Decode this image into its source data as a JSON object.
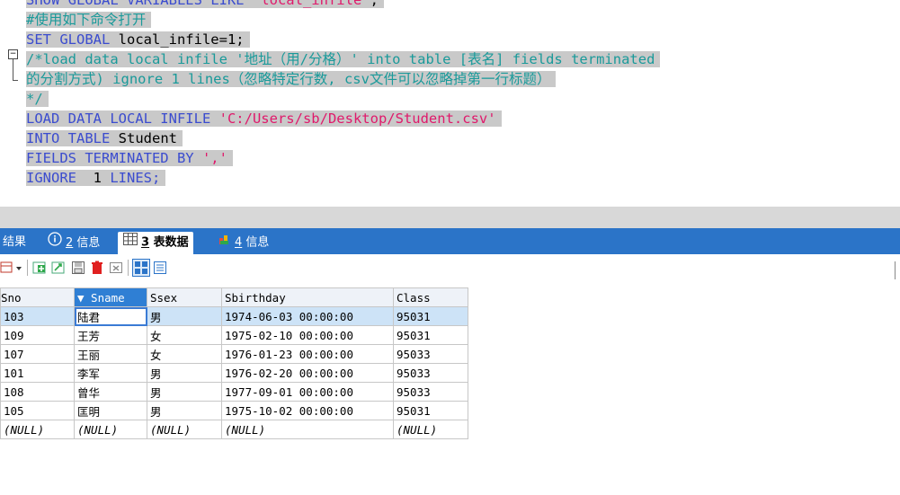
{
  "editor": {
    "lines": [
      {
        "parts": [
          {
            "t": "SHOW GLOBAL VARIABLES LIKE ",
            "c": "kw"
          },
          {
            "t": "'local_infile'",
            "c": "str"
          },
          {
            "t": ";",
            "c": "plain"
          }
        ]
      },
      {
        "parts": [
          {
            "t": "#使用如下命令打开",
            "c": "cmt"
          }
        ]
      },
      {
        "parts": [
          {
            "t": "SET GLOBAL ",
            "c": "kw"
          },
          {
            "t": "local_infile=1;",
            "c": "plain"
          }
        ]
      },
      {
        "parts": [
          {
            "t": "/*load data local infile '地址（用/分格）' into table [表名] fields terminated",
            "c": "cmt"
          }
        ]
      },
      {
        "parts": [
          {
            "t": "的分割方式) ignore 1 lines（忽略特定行数, csv文件可以忽略掉第一行标题）",
            "c": "cmt"
          }
        ]
      },
      {
        "parts": [
          {
            "t": "*/",
            "c": "cmt"
          }
        ]
      },
      {
        "parts": [
          {
            "t": "LOAD DATA LOCAL INFILE ",
            "c": "kw"
          },
          {
            "t": "'C:/Users/sb/Desktop/Student.csv'",
            "c": "str"
          }
        ]
      },
      {
        "parts": [
          {
            "t": "INTO TABLE ",
            "c": "kw"
          },
          {
            "t": "Student",
            "c": "plain"
          }
        ]
      },
      {
        "parts": [
          {
            "t": "FIELDS TERMINATED BY ",
            "c": "kw"
          },
          {
            "t": "','",
            "c": "str"
          }
        ]
      },
      {
        "parts": [
          {
            "t": "IGNORE  ",
            "c": "kw"
          },
          {
            "t": "1",
            "c": "plain"
          },
          {
            "t": " LINES;",
            "c": "kw"
          }
        ]
      }
    ]
  },
  "tabs": {
    "result_label": "结果",
    "info_num": "2",
    "info_label": "信息",
    "table_num": "3",
    "table_label": "表数据",
    "info2_num": "4",
    "info2_label": "信息"
  },
  "grid": {
    "columns": [
      "Sno",
      "▼ Sname",
      "Ssex",
      "Sbirthday",
      "Class"
    ],
    "rows": [
      [
        "103",
        "陆君",
        "男",
        "1974-06-03 00:00:00",
        "95031"
      ],
      [
        "109",
        "王芳",
        "女",
        "1975-02-10 00:00:00",
        "95031"
      ],
      [
        "107",
        "王丽",
        "女",
        "1976-01-23 00:00:00",
        "95033"
      ],
      [
        "101",
        "李军",
        "男",
        "1976-02-20 00:00:00",
        "95033"
      ],
      [
        "108",
        "曾华",
        "男",
        "1977-09-01 00:00:00",
        "95033"
      ],
      [
        "105",
        "匡明",
        "男",
        "1975-10-02 00:00:00",
        "95031"
      ],
      [
        "(NULL)",
        "(NULL)",
        "(NULL)",
        "(NULL)",
        "(NULL)"
      ]
    ]
  },
  "colors": {
    "keyword": "#3b4ccf",
    "string": "#e0196b",
    "comment": "#1a9a9a",
    "tabbar": "#2b74c8",
    "selection": "#cde3f7"
  }
}
